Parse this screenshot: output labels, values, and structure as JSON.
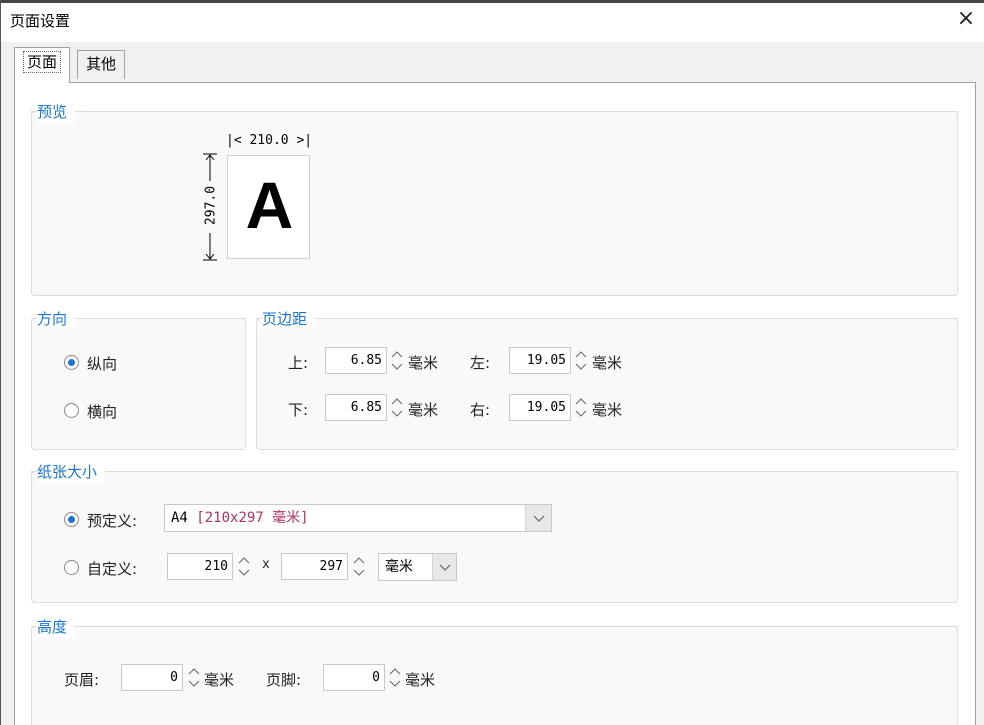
{
  "window": {
    "title": "页面设置",
    "close_glyph": "×"
  },
  "tabs": [
    {
      "label": "页面",
      "active": true
    },
    {
      "label": "其他",
      "active": false
    }
  ],
  "preview": {
    "legend": "预览",
    "width_label": "|< 210.0 >|",
    "height_label": "297.0",
    "letter": "A"
  },
  "orientation": {
    "legend": "方向",
    "options": [
      {
        "label": "纵向",
        "selected": true
      },
      {
        "label": "横向",
        "selected": false
      }
    ]
  },
  "margins": {
    "legend": "页边距",
    "unit": "毫米",
    "top": {
      "label": "上:",
      "value": "6.85"
    },
    "bottom": {
      "label": "下:",
      "value": "6.85"
    },
    "left": {
      "label": "左:",
      "value": "19.05"
    },
    "right": {
      "label": "右:",
      "value": "19.05"
    }
  },
  "paper": {
    "legend": "纸张大小",
    "predefined": {
      "label": "预定义:",
      "selected": true,
      "value_code": "A4",
      "value_size": "[210x297 毫米]"
    },
    "custom": {
      "label": "自定义:",
      "selected": false,
      "width": "210",
      "times": "x",
      "height": "297",
      "unit": "毫米"
    }
  },
  "height": {
    "legend": "高度",
    "unit": "毫米",
    "header": {
      "label": "页眉:",
      "value": "0"
    },
    "footer": {
      "label": "页脚:",
      "value": "0"
    }
  },
  "colors": {
    "accent": "#1a75d2",
    "code_red": "#b03060"
  }
}
